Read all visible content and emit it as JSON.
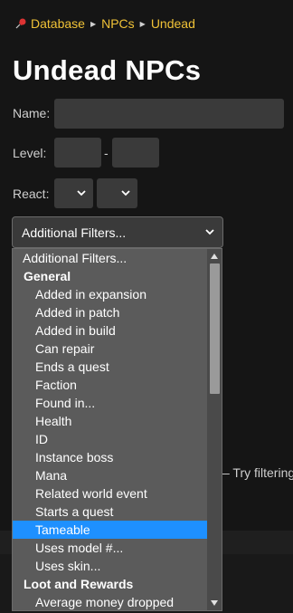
{
  "breadcrumb": [
    "Database",
    "NPCs",
    "Undead"
  ],
  "page_title": "Undead NPCs",
  "form": {
    "name_label": "Name:",
    "level_label": "Level:",
    "level_sep": "-",
    "react_label": "React:"
  },
  "filters": {
    "selected": "Additional Filters...",
    "options": [
      {
        "label": "Additional Filters...",
        "kind": "placeholder"
      },
      {
        "label": "General",
        "kind": "group"
      },
      {
        "label": "Added in expansion",
        "kind": "option"
      },
      {
        "label": "Added in patch",
        "kind": "option"
      },
      {
        "label": "Added in build",
        "kind": "option"
      },
      {
        "label": "Can repair",
        "kind": "option"
      },
      {
        "label": "Ends a quest",
        "kind": "option"
      },
      {
        "label": "Faction",
        "kind": "option"
      },
      {
        "label": "Found in...",
        "kind": "option"
      },
      {
        "label": "Health",
        "kind": "option"
      },
      {
        "label": "ID",
        "kind": "option"
      },
      {
        "label": "Instance boss",
        "kind": "option"
      },
      {
        "label": "Mana",
        "kind": "option"
      },
      {
        "label": "Related world event",
        "kind": "option"
      },
      {
        "label": "Starts a quest",
        "kind": "option"
      },
      {
        "label": "Tameable",
        "kind": "option",
        "selected": true
      },
      {
        "label": "Uses model #...",
        "kind": "option"
      },
      {
        "label": "Uses skin...",
        "kind": "option"
      },
      {
        "label": "Loot and Rewards",
        "kind": "group"
      },
      {
        "label": "Average money dropped",
        "kind": "option"
      }
    ]
  },
  "behind_text": "– Try filtering",
  "colors": {
    "accent": "#f0c237",
    "highlight": "#1e90ff"
  }
}
